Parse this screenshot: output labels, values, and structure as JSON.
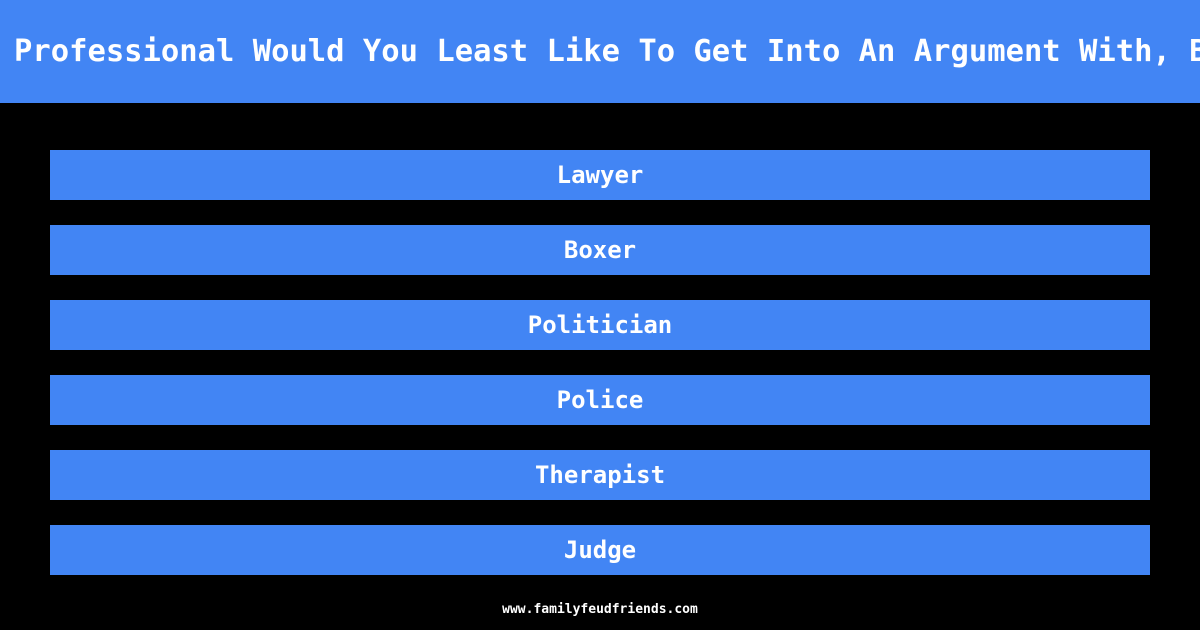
{
  "theme": {
    "background_color": "#000000",
    "accent_color": "#4285f4",
    "text_color": "#ffffff"
  },
  "header": {
    "question": "Professional Would You Least Like To Get Into An Argument With, Because Yo",
    "clipped_left": true,
    "clipped_right": true
  },
  "answers": [
    {
      "rank": 1,
      "label": "Lawyer"
    },
    {
      "rank": 2,
      "label": "Boxer"
    },
    {
      "rank": 3,
      "label": "Politician"
    },
    {
      "rank": 4,
      "label": "Police"
    },
    {
      "rank": 5,
      "label": "Therapist"
    },
    {
      "rank": 6,
      "label": "Judge"
    }
  ],
  "footer": {
    "site": "www.familyfeudfriends.com"
  }
}
